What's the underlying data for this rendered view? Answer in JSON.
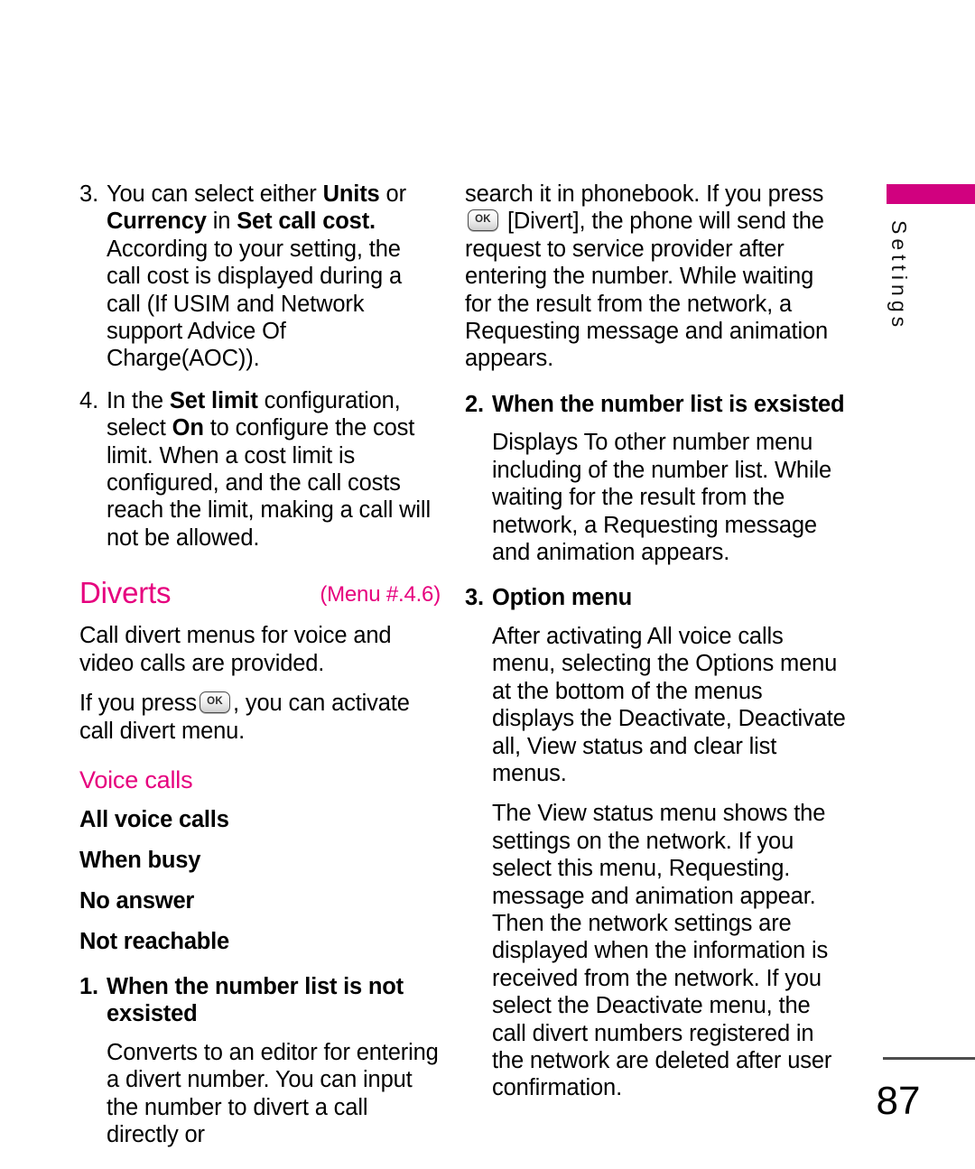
{
  "page": {
    "number": "87",
    "tab_label": "Settings",
    "accent_color": "#E6007E",
    "tab_bar_color": "#D1017F"
  },
  "left_column": {
    "item3": {
      "num": "3.",
      "parts": [
        {
          "text": "You can select either ",
          "bold": false
        },
        {
          "text": "Units",
          "bold": true
        },
        {
          "text": " or ",
          "bold": false
        },
        {
          "text": "Currency",
          "bold": true
        },
        {
          "text": " in ",
          "bold": false
        },
        {
          "text": "Set call cost.",
          "bold": true
        },
        {
          "text": " According to your setting, the call cost is displayed during a call (If USIM and Network support Advice Of Charge(AOC)).",
          "bold": false
        }
      ]
    },
    "item4": {
      "num": "4.",
      "parts": [
        {
          "text": "In the ",
          "bold": false
        },
        {
          "text": "Set limit",
          "bold": true
        },
        {
          "text": " configuration, select ",
          "bold": false
        },
        {
          "text": "On",
          "bold": true
        },
        {
          "text": " to configure the cost limit. When a cost limit is configured, and the call costs reach the limit, making a call will not be allowed.",
          "bold": false
        }
      ]
    },
    "diverts_heading": "Diverts",
    "diverts_menu_ref": "(Menu #.4.6)",
    "diverts_intro": "Call divert menus for voice and video calls are provided.",
    "diverts_press": {
      "before": "If you press",
      "key": "OK",
      "after": ", you can activate call divert menu."
    },
    "voice_calls_heading": "Voice calls",
    "menu_entries": [
      "All voice calls",
      "When busy",
      "No answer",
      "Not reachable"
    ],
    "item1": {
      "num": "1.",
      "title": "When the number list is not exsisted",
      "body": "Converts to an editor for entering a divert number. You can input the number to divert a call directly or"
    }
  },
  "right_column": {
    "continued": {
      "before": "search it in phonebook. If you press",
      "key": "OK",
      "after": "[Divert], the phone will send the request to service provider after entering the number. While waiting for the result from the network, a Requesting message and animation appears."
    },
    "item2": {
      "num": "2.",
      "title": "When the number list is exsisted",
      "body": "Displays To other number menu including of the number list. While waiting for the result from the network, a Requesting message and animation appears."
    },
    "item3": {
      "num": "3.",
      "title": "Option menu",
      "body1": "After activating All voice calls menu, selecting the Options menu at the bottom of the menus displays the Deactivate,  Deactivate all, View status and clear list menus.",
      "body2": "The View status menu shows the settings on the network. If you select this menu, Requesting. message and animation appear. Then the network settings are displayed when the information is received from the network. If you select the Deactivate menu, the call divert numbers registered in the network are deleted after user confirmation."
    }
  }
}
